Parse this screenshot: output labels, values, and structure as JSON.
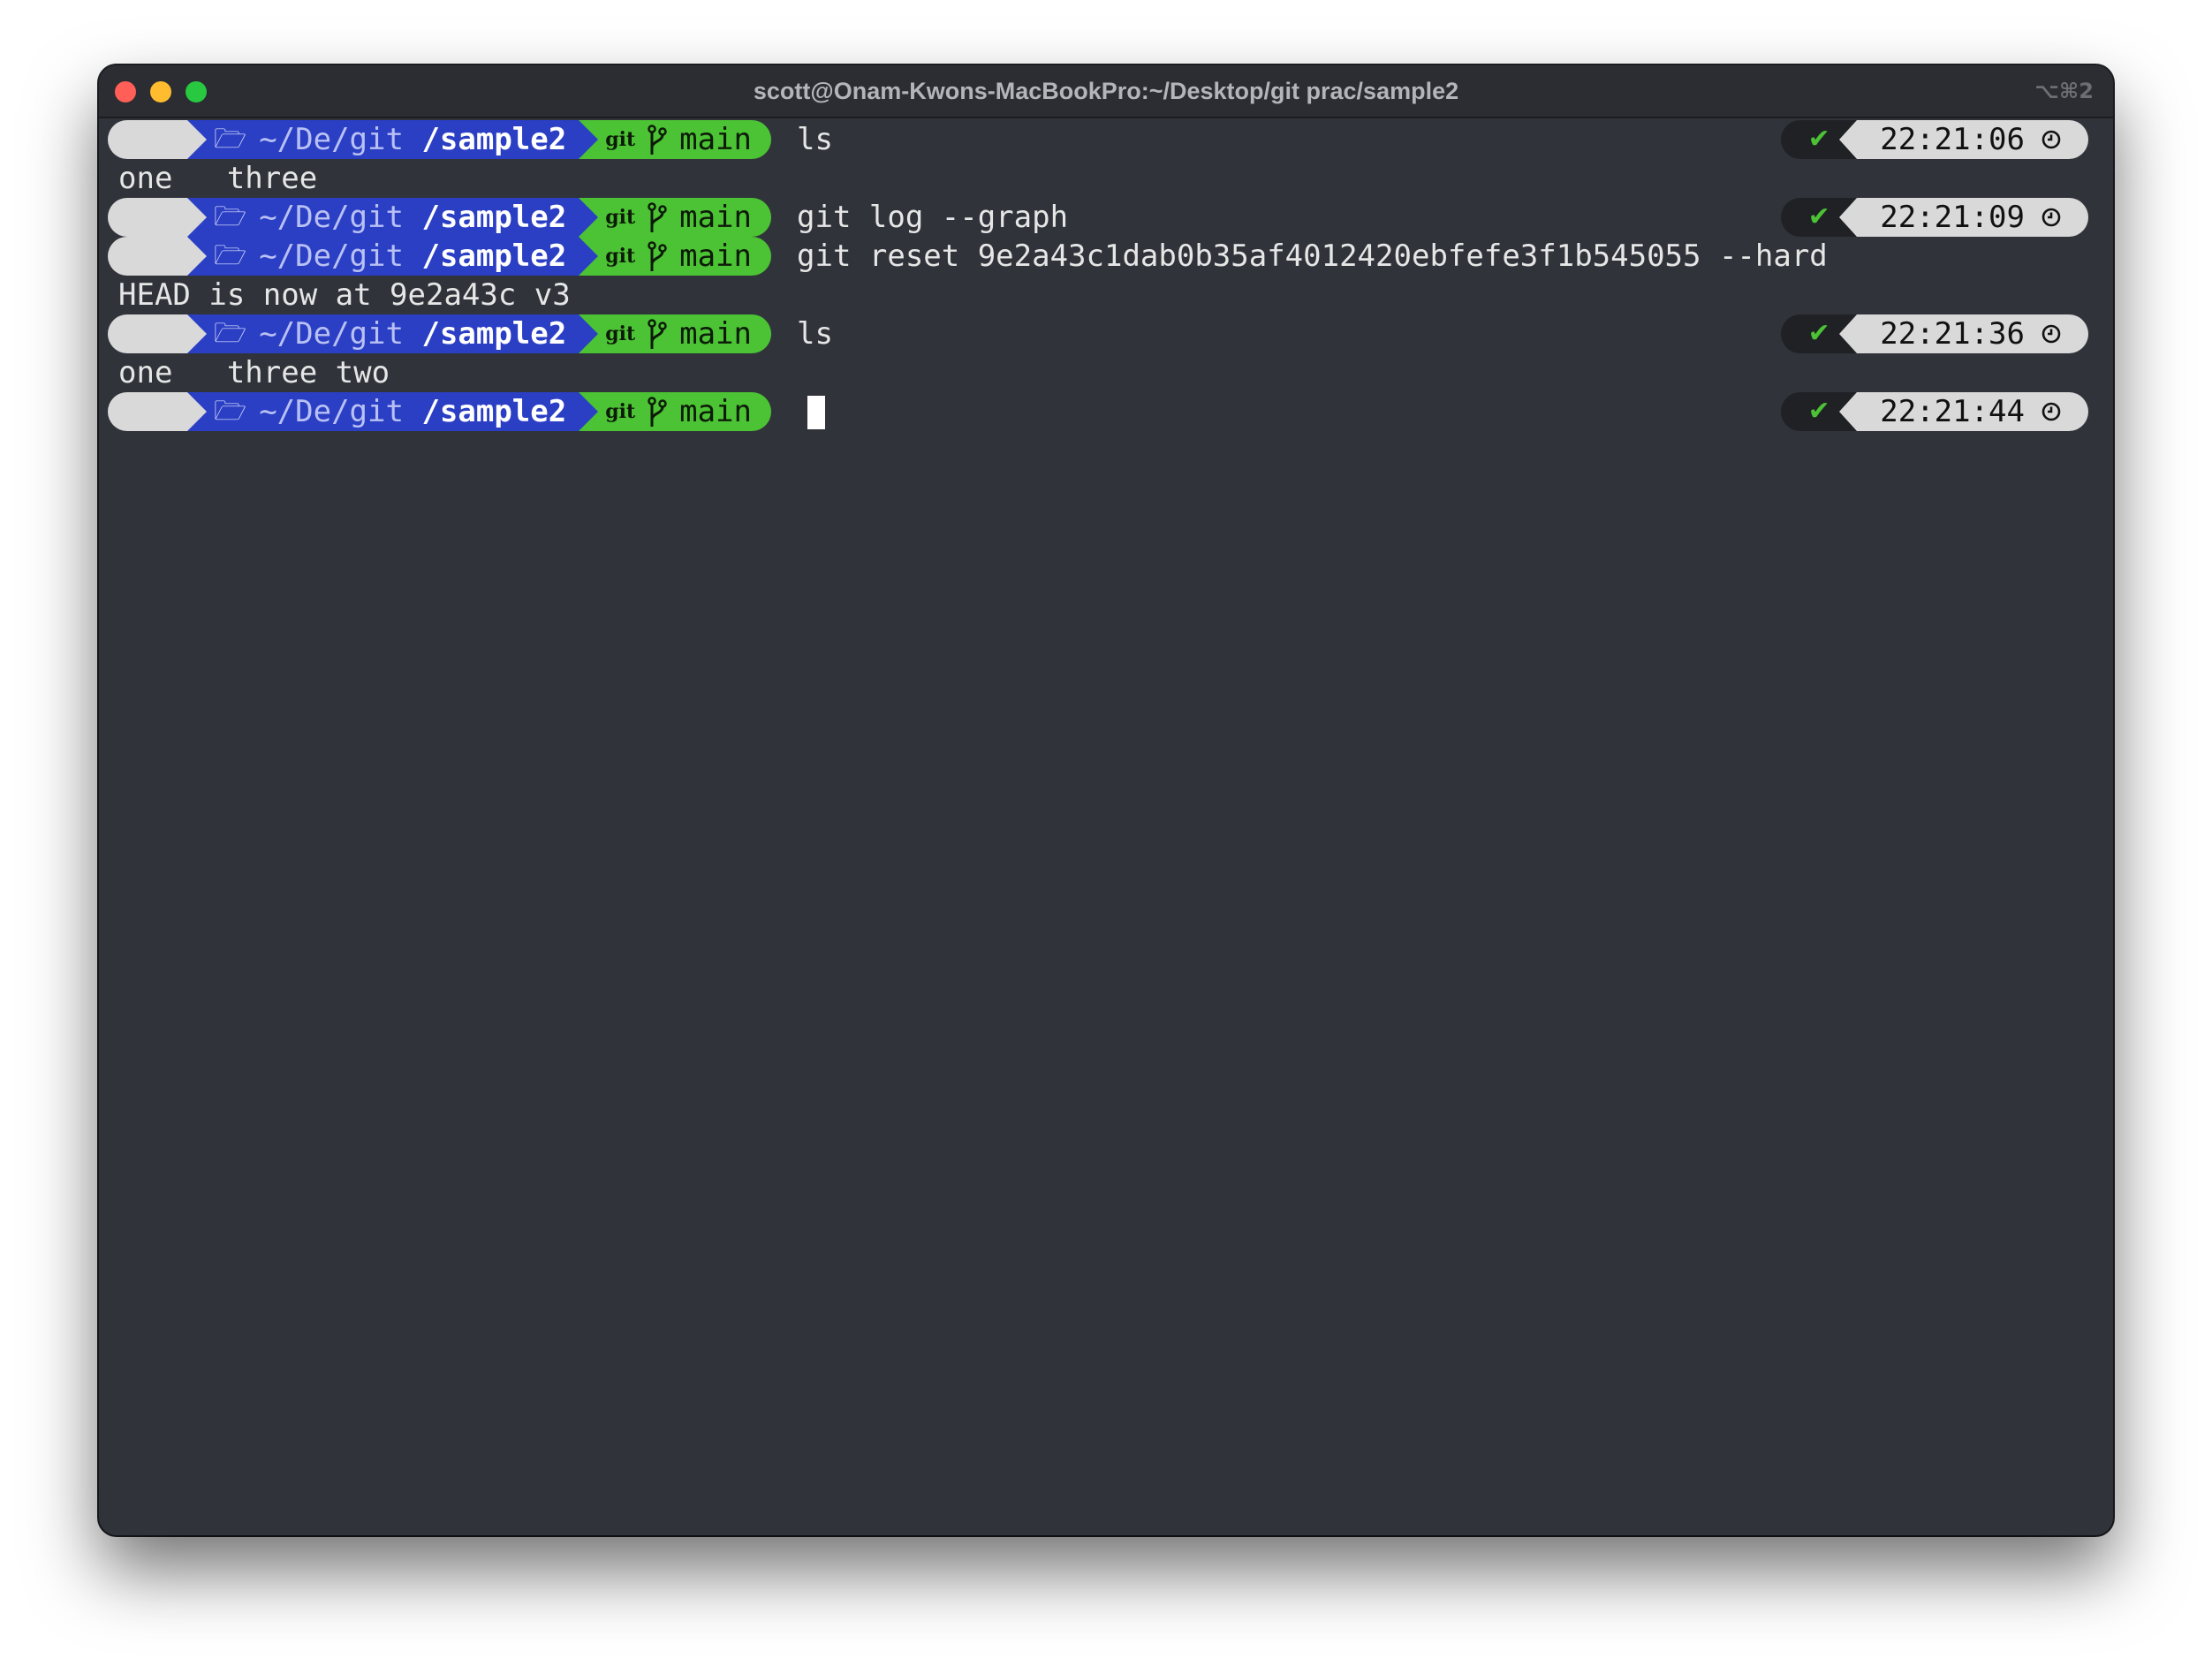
{
  "window": {
    "title": "scott@Onam-Kwons-MacBookPro:~/Desktop/git prac/sample2",
    "shortcut": "⌥⌘2"
  },
  "prompt": {
    "path_prefix": "~/De/git ",
    "path_current": "/sample2",
    "git_label": "git",
    "branch": "main",
    "status": "✔"
  },
  "lines": [
    {
      "kind": "prompt",
      "command": "ls",
      "time": "22:21:06"
    },
    {
      "kind": "output",
      "text": "one   three"
    },
    {
      "kind": "prompt",
      "command": "git log --graph",
      "time": "22:21:09"
    },
    {
      "kind": "prompt",
      "command": "git reset 9e2a43c1dab0b35af4012420ebfefe3f1b545055 --hard",
      "time": ""
    },
    {
      "kind": "output",
      "text": "HEAD is now at 9e2a43c v3"
    },
    {
      "kind": "prompt",
      "command": "ls",
      "time": "22:21:36"
    },
    {
      "kind": "output",
      "text": "one   three two"
    },
    {
      "kind": "prompt",
      "command": "",
      "time": "22:21:44",
      "cursor": true
    }
  ],
  "colors": {
    "terminal_bg": "#30333a",
    "apple_segment": "#d9d9d9",
    "path_segment": "#2b3fc4",
    "git_segment": "#4bc334",
    "status_ok": "#4bc334",
    "time_segment": "#d9d9d9"
  },
  "icons": {
    "apple": "apple-logo-icon",
    "folder": "folder-open-icon",
    "git": "git-logo-icon",
    "branch": "git-branch-icon",
    "check": "checkmark-icon",
    "clock": "clock-icon"
  }
}
